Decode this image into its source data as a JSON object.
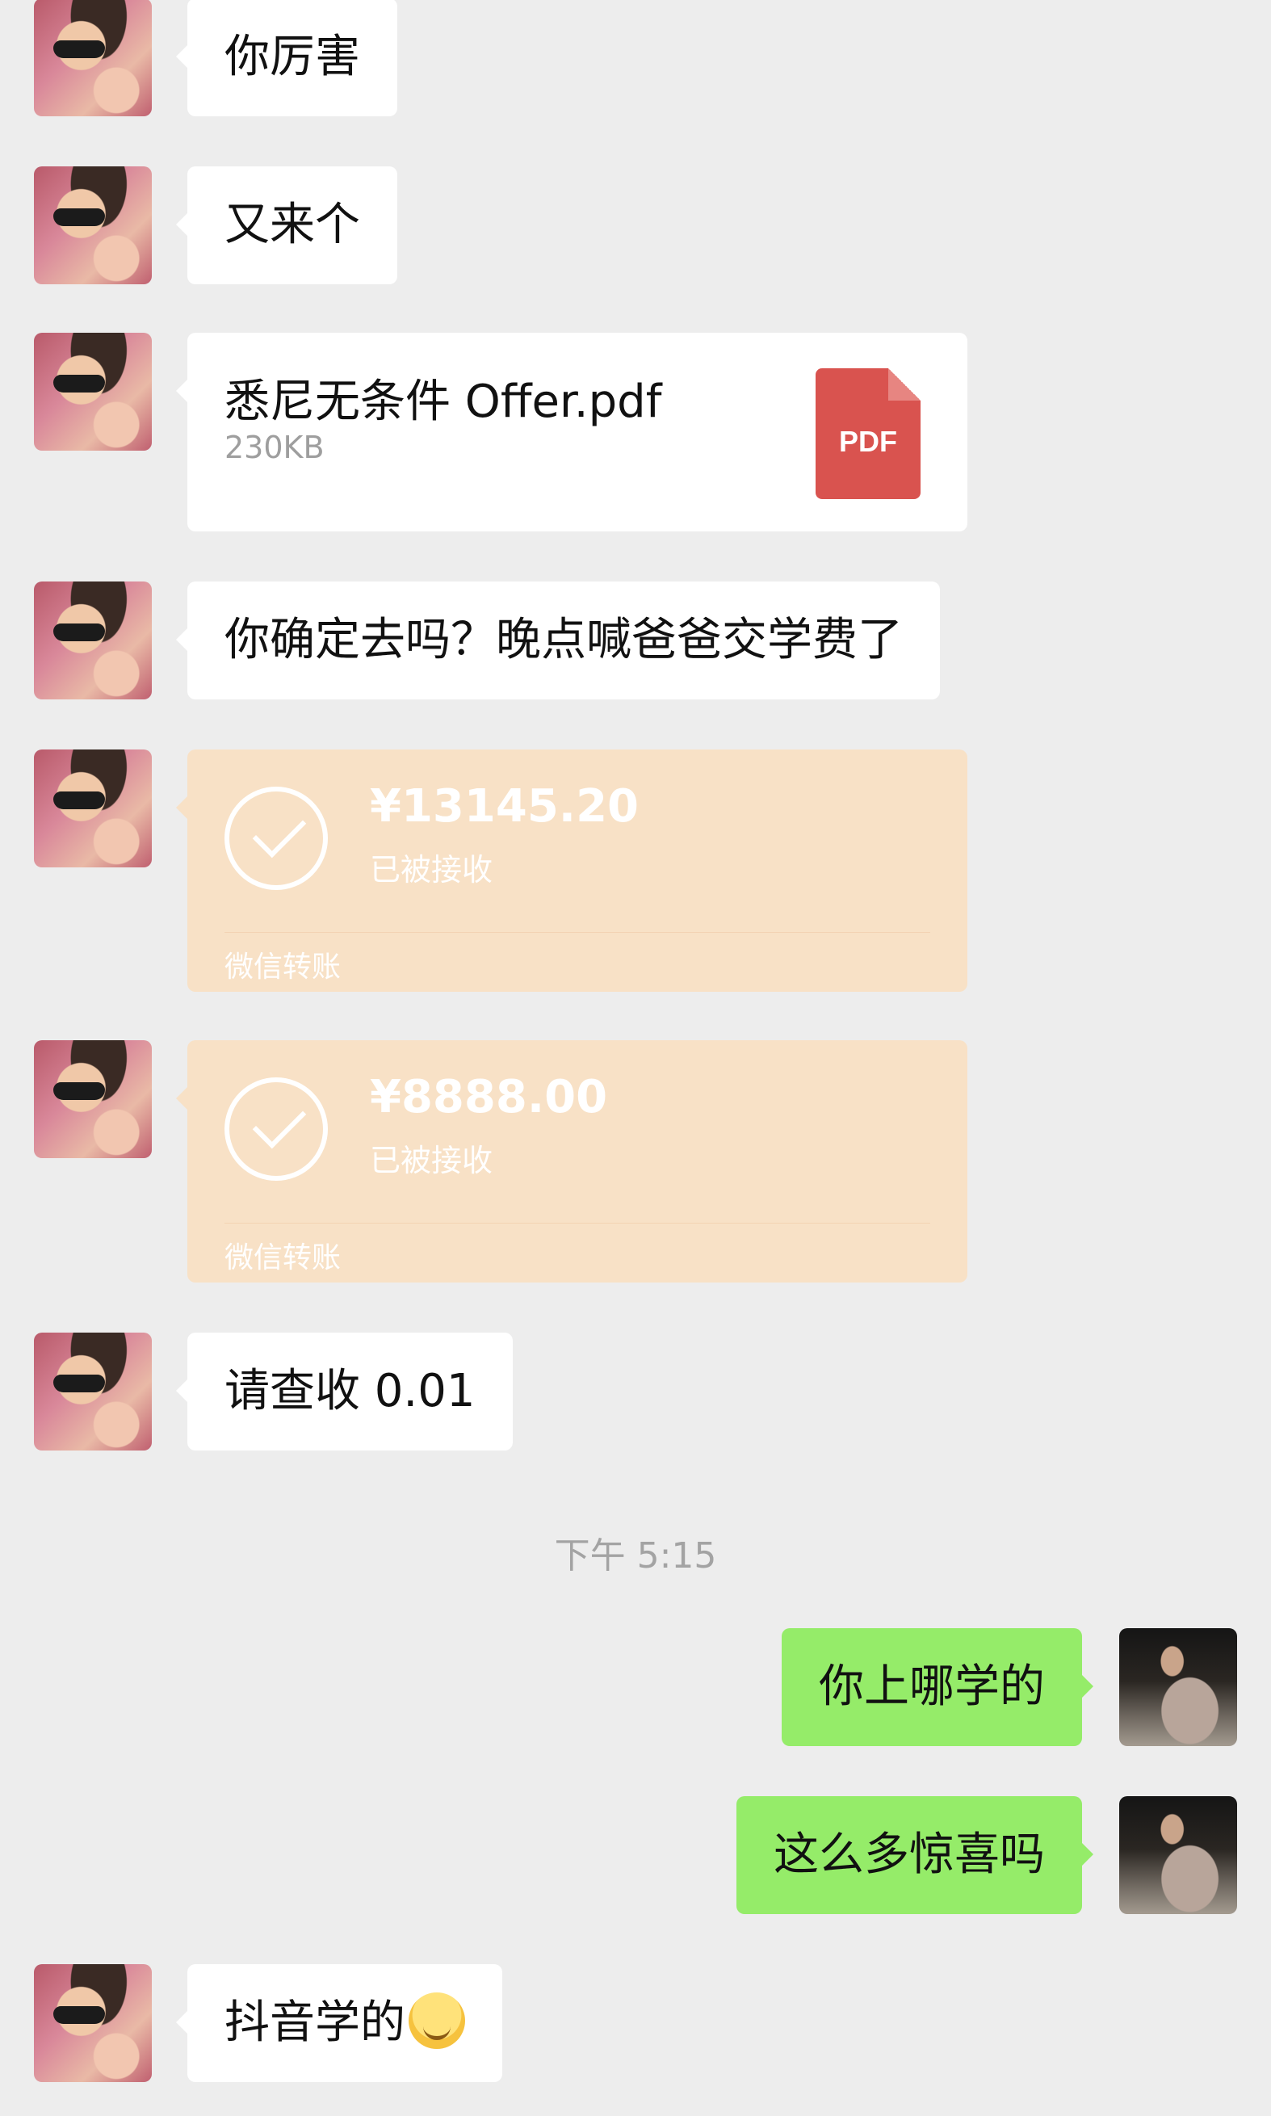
{
  "messages": {
    "m1": "你厉害",
    "m2": "又来个",
    "file": {
      "name": "悉尼无条件 Offer.pdf",
      "size": "230KB",
      "icon_label": "PDF"
    },
    "m4": "你确定去吗？晚点喊爸爸交学费了",
    "transfer1": {
      "amount": "¥13145.20",
      "status": "已被接收",
      "label": "微信转账"
    },
    "transfer2": {
      "amount": "¥8888.00",
      "status": "已被接收",
      "label": "微信转账"
    },
    "m7": "请查收 0.01",
    "timestamp": "下午 5:15",
    "m8": "你上哪学的",
    "m9": "这么多惊喜吗",
    "m10": "抖音学的"
  },
  "colors": {
    "background": "#ededed",
    "self_bubble": "#95ec69",
    "transfer_bubble": "#f8e1c6",
    "pdf_red": "#d9534f"
  },
  "icons": {
    "transfer_check": "check-circle-icon",
    "file": "pdf-icon",
    "emoji": "hugging-face-emoji"
  }
}
